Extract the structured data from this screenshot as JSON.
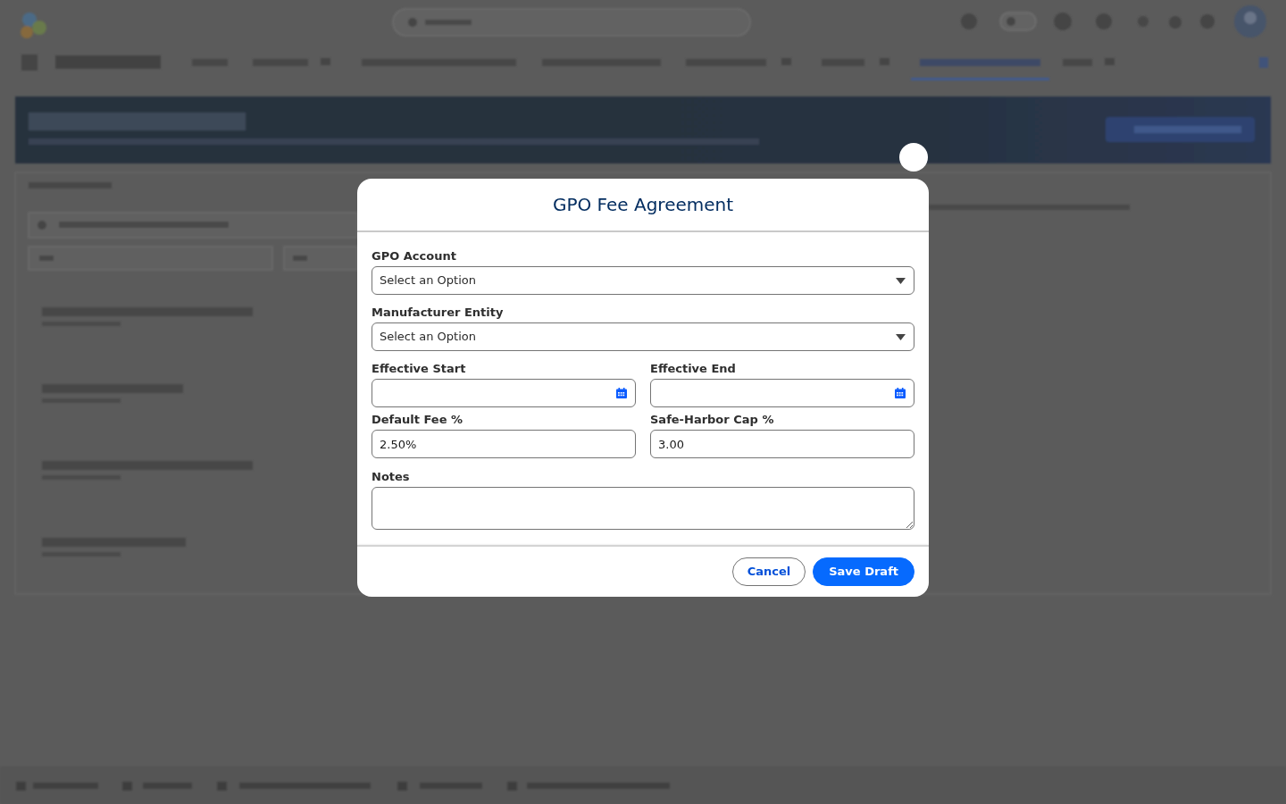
{
  "modal": {
    "title": "GPO Fee Agreement",
    "rows": [
      {
        "fields": [
          {
            "label": "GPO Account",
            "kind": "select",
            "placeholder": "Select an Option"
          }
        ]
      },
      {
        "fields": [
          {
            "label": "Manufacturer Entity",
            "kind": "select",
            "placeholder": "Select an Option"
          }
        ]
      },
      {
        "fields": [
          {
            "label": "Effective Start",
            "kind": "date"
          },
          {
            "label": "Effective End",
            "kind": "date"
          }
        ]
      },
      {
        "fields": [
          {
            "label": "Default Fee %",
            "kind": "text",
            "value": "2.50%"
          },
          {
            "label": "Safe-Harbor Cap %",
            "kind": "text",
            "value": "3.00"
          }
        ]
      },
      {
        "fields": [
          {
            "label": "Notes",
            "kind": "textarea"
          }
        ]
      }
    ],
    "buttons": [
      {
        "label": "Cancel",
        "kind": "neutral"
      },
      {
        "label": "Save Draft",
        "kind": "brand"
      }
    ]
  }
}
